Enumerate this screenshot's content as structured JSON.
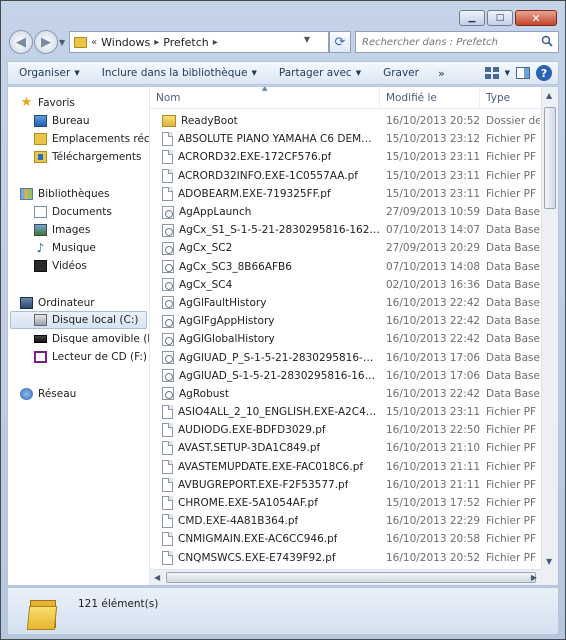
{
  "window": {
    "minimize_glyph": "▁",
    "maximize_glyph": "□",
    "close_glyph": "✕"
  },
  "address": {
    "segments": [
      "Windows",
      "Prefetch"
    ],
    "prefix": "«"
  },
  "search": {
    "placeholder": "Rechercher dans : Prefetch"
  },
  "toolbar": {
    "organize": "Organiser",
    "include": "Inclure dans la bibliothèque",
    "share": "Partager avec",
    "burn": "Graver",
    "more": "»"
  },
  "nav": {
    "favorites": "Favoris",
    "desktop": "Bureau",
    "recent": "Emplacements récents",
    "downloads": "Téléchargements",
    "libraries": "Bibliothèques",
    "documents": "Documents",
    "images": "Images",
    "music": "Musique",
    "videos": "Vidéos",
    "computer": "Ordinateur",
    "local_disk": "Disque local (C:)",
    "removable": "Disque amovible (E:)",
    "cd": "Lecteur de CD (F:) M",
    "network": "Réseau"
  },
  "columns": {
    "name": "Nom",
    "modified": "Modifié le",
    "type": "Type"
  },
  "files": [
    {
      "name": "ReadyBoot",
      "date": "16/10/2013 20:52",
      "type": "Dossier de fi",
      "icon": "folder"
    },
    {
      "name": "ABSOLUTE PIANO YAMAHA C6 DEMO-F...",
      "date": "15/10/2013 23:12",
      "type": "Fichier PF",
      "icon": "file"
    },
    {
      "name": "ACRORD32.EXE-172CF576.pf",
      "date": "15/10/2013 23:11",
      "type": "Fichier PF",
      "icon": "file"
    },
    {
      "name": "ACRORD32INFO.EXE-1C0557AA.pf",
      "date": "15/10/2013 23:11",
      "type": "Fichier PF",
      "icon": "file"
    },
    {
      "name": "ADOBEARM.EXE-719325FF.pf",
      "date": "15/10/2013 23:11",
      "type": "Fichier PF",
      "icon": "file"
    },
    {
      "name": "AgAppLaunch",
      "date": "27/09/2013 10:59",
      "type": "Data Base Fi",
      "icon": "db"
    },
    {
      "name": "AgCx_S1_S-1-5-21-2830295816-16260489...",
      "date": "07/10/2013 14:07",
      "type": "Data Base Fi",
      "icon": "db"
    },
    {
      "name": "AgCx_SC2",
      "date": "27/09/2013 20:29",
      "type": "Data Base Fi",
      "icon": "db"
    },
    {
      "name": "AgCx_SC3_8B66AFB6",
      "date": "07/10/2013 14:08",
      "type": "Data Base Fi",
      "icon": "db"
    },
    {
      "name": "AgCx_SC4",
      "date": "02/10/2013 16:36",
      "type": "Data Base Fi",
      "icon": "db"
    },
    {
      "name": "AgGlFaultHistory",
      "date": "16/10/2013 22:42",
      "type": "Data Base Fi",
      "icon": "db"
    },
    {
      "name": "AgGlFgAppHistory",
      "date": "16/10/2013 22:42",
      "type": "Data Base Fi",
      "icon": "db"
    },
    {
      "name": "AgGlGlobalHistory",
      "date": "16/10/2013 22:42",
      "type": "Data Base Fi",
      "icon": "db"
    },
    {
      "name": "AgGlUAD_P_S-1-5-21-2830295816-16260...",
      "date": "16/10/2013 17:06",
      "type": "Data Base Fi",
      "icon": "db"
    },
    {
      "name": "AgGlUAD_S-1-5-21-2830295816-1626048...",
      "date": "16/10/2013 17:06",
      "type": "Data Base Fi",
      "icon": "db"
    },
    {
      "name": "AgRobust",
      "date": "16/10/2013 22:42",
      "type": "Data Base Fi",
      "icon": "db"
    },
    {
      "name": "ASIO4ALL_2_10_ENGLISH.EXE-A2C4FB9E.pf",
      "date": "15/10/2013 23:11",
      "type": "Fichier PF",
      "icon": "file"
    },
    {
      "name": "AUDIODG.EXE-BDFD3029.pf",
      "date": "16/10/2013 22:50",
      "type": "Fichier PF",
      "icon": "file"
    },
    {
      "name": "AVAST.SETUP-3DA1C849.pf",
      "date": "16/10/2013 21:10",
      "type": "Fichier PF",
      "icon": "file"
    },
    {
      "name": "AVASTEMUPDATE.EXE-FAC018C6.pf",
      "date": "16/10/2013 21:11",
      "type": "Fichier PF",
      "icon": "file"
    },
    {
      "name": "AVBUGREPORT.EXE-F2F53577.pf",
      "date": "16/10/2013 21:11",
      "type": "Fichier PF",
      "icon": "file"
    },
    {
      "name": "CHROME.EXE-5A1054AF.pf",
      "date": "15/10/2013 17:52",
      "type": "Fichier PF",
      "icon": "file"
    },
    {
      "name": "CMD.EXE-4A81B364.pf",
      "date": "16/10/2013 22:29",
      "type": "Fichier PF",
      "icon": "file"
    },
    {
      "name": "CNMIGMAIN.EXE-AC6CC946.pf",
      "date": "16/10/2013 20:58",
      "type": "Fichier PF",
      "icon": "file"
    },
    {
      "name": "CNQMSWCS.EXE-E7439F92.pf",
      "date": "16/10/2013 20:52",
      "type": "Fichier PF",
      "icon": "file"
    }
  ],
  "status": {
    "count": "121 élément(s)"
  }
}
